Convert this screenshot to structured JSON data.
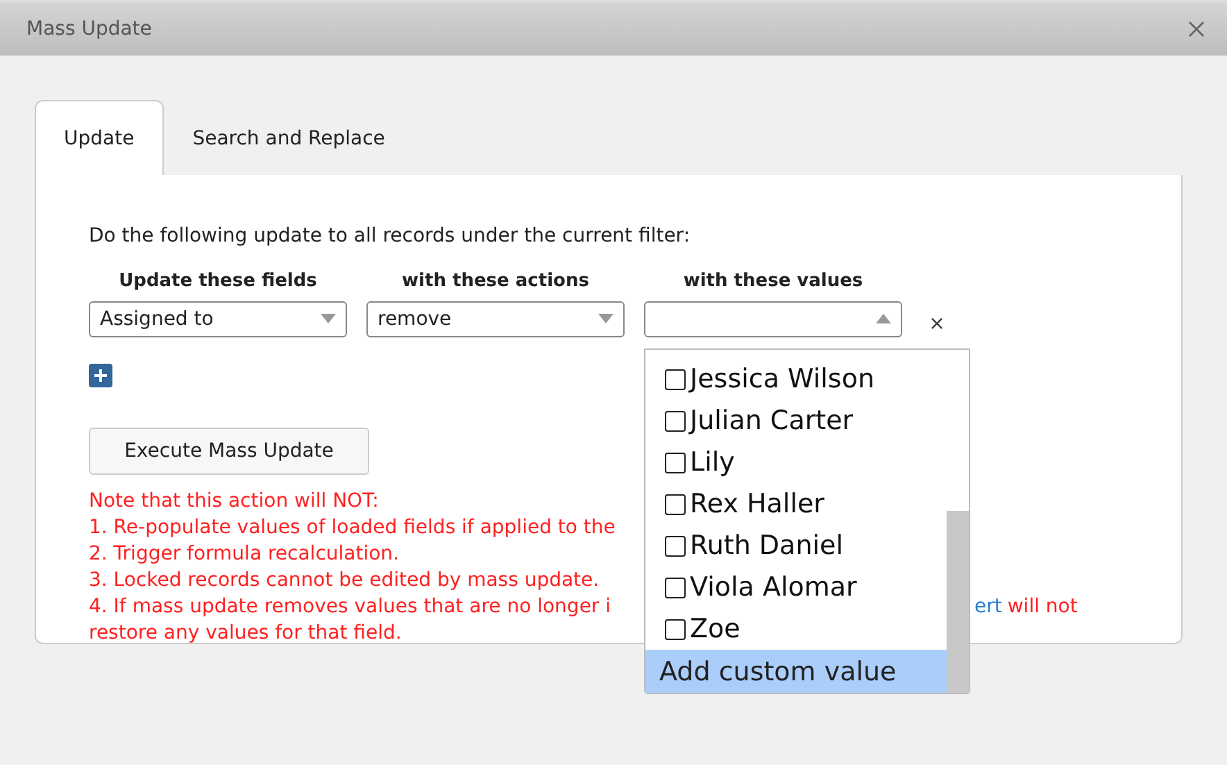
{
  "window": {
    "title": "Mass Update"
  },
  "tabs": [
    {
      "label": "Update",
      "selected": true
    },
    {
      "label": "Search and Replace",
      "selected": false
    }
  ],
  "intro": "Do the following update to all records under the current filter:",
  "columns": [
    "Update these fields",
    "with these actions",
    "with these values"
  ],
  "row": {
    "field": "Assigned to",
    "action": "remove",
    "remove_icon": "×"
  },
  "dropdown": {
    "expanded": true,
    "options": [
      {
        "label": "Jessica Wilson",
        "checked": false
      },
      {
        "label": "Julian Carter",
        "checked": false
      },
      {
        "label": "Lily",
        "checked": false
      },
      {
        "label": "Rex Haller",
        "checked": false
      },
      {
        "label": "Ruth Daniel",
        "checked": false
      },
      {
        "label": "Viola Alomar",
        "checked": false
      },
      {
        "label": "Zoe",
        "checked": false
      }
    ],
    "custom": {
      "label": "Add custom value",
      "selected": true
    }
  },
  "execute_button": "Execute Mass Update",
  "notes": {
    "heading": "Note that this action will NOT:",
    "lines": [
      "1. Re-populate values of loaded fields if applied to the",
      "2. Trigger formula recalculation.",
      "3. Locked records cannot be edited by mass update.",
      "4. If mass update removes values that are no longer i"
    ],
    "link": "ert",
    "line4_end": "will not",
    "line5": "restore any values for that field."
  }
}
